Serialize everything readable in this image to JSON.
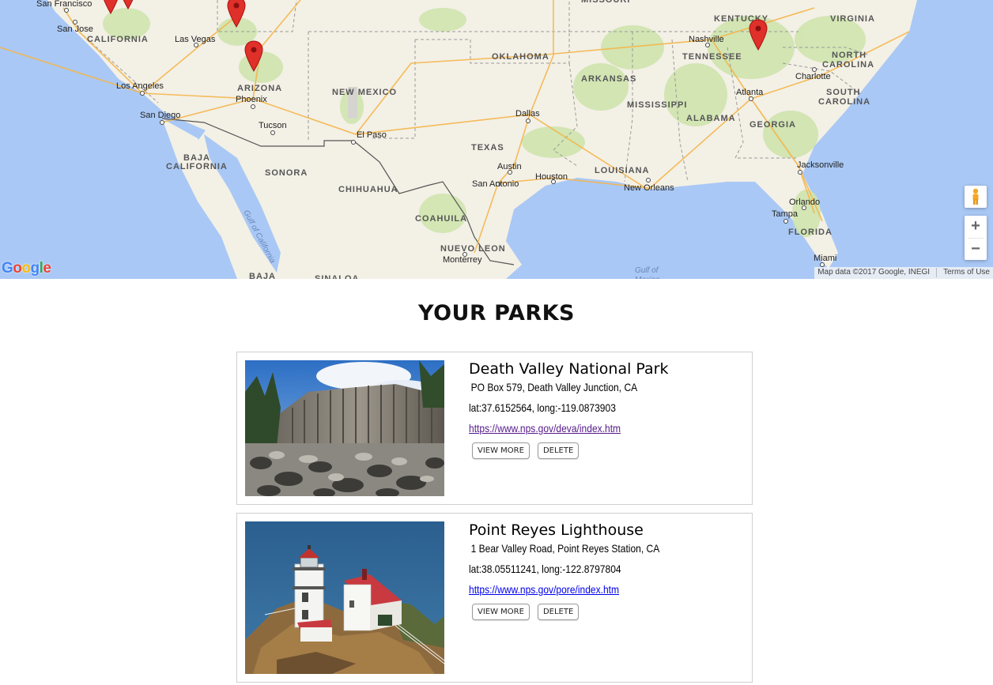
{
  "map": {
    "state_labels": [
      "CALIFORNIA",
      "ARIZONA",
      "NEW MEXICO",
      "OKLAHOMA",
      "TEXAS",
      "ARKANSAS",
      "MISSISSIPPI",
      "ALABAMA",
      "GEORGIA",
      "TENNESSEE",
      "KENTUCKY",
      "VIRGINIA",
      "NORTH",
      "CAROLINA",
      "SOUTH",
      "CAROLINA",
      "LOUISIANA",
      "FLORIDA",
      "BAJA",
      "CALIFORNIA",
      "SONORA",
      "CHIHUAHUA",
      "COAHUILA",
      "NUEVO LEON",
      "MISSOURI",
      "BAJA",
      "SINALOA"
    ],
    "city_labels": [
      "San Francisco",
      "San Jose",
      "Las Vegas",
      "Los Angeles",
      "Phoenix",
      "San Diego",
      "Tucson",
      "El Paso",
      "Dallas",
      "Austin",
      "Houston",
      "San Antonio",
      "New Orleans",
      "Nashville",
      "Atlanta",
      "Charlotte",
      "Jacksonville",
      "Orlando",
      "Tampa",
      "Miami",
      "Monterrey"
    ],
    "water_labels": [
      "Gulf of California",
      "Gulf of Mexico"
    ],
    "markers": [
      "marker-nevada",
      "marker-arizona",
      "marker-tennessee"
    ],
    "logo": "Google",
    "attribution": "Map data ©2017 Google, INEGI",
    "terms": "Terms of Use",
    "zoom_in": "+",
    "zoom_out": "−",
    "colors": {
      "water": "#a9c8f5",
      "land": "#f4f1e8",
      "park": "#c7e0a8",
      "road": "#f5b64a",
      "marker": "#e0302a"
    }
  },
  "heading": "YOUR PARKS",
  "parks": [
    {
      "name": "Death Valley National Park",
      "address": "PO Box 579,  Death Valley Junction,  CA",
      "coords": "lat:37.6152564, long:-119.0873903",
      "url": "https://www.nps.gov/deva/index.htm",
      "url_color": "#551a8b",
      "view_label": "VIEW MORE",
      "delete_label": "DELETE",
      "photo": "basalt-columns-photo"
    },
    {
      "name": "Point Reyes Lighthouse",
      "address": "1 Bear Valley Road,  Point Reyes Station,  CA",
      "coords": "lat:38.05511241, long:-122.8797804",
      "url": "https://www.nps.gov/pore/index.htm",
      "url_color": "#0000ee",
      "view_label": "VIEW MORE",
      "delete_label": "DELETE",
      "photo": "lighthouse-photo"
    }
  ]
}
